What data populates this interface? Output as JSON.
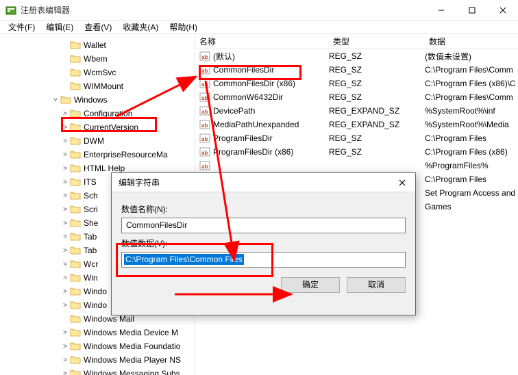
{
  "window": {
    "title": "注册表编辑器"
  },
  "menu": {
    "file": "文件(F)",
    "edit": "编辑(E)",
    "view": "查看(V)",
    "fav": "收藏夹(A)",
    "help": "帮助(H)"
  },
  "tree": [
    {
      "indent": 88,
      "expander": "",
      "label": "Wallet"
    },
    {
      "indent": 88,
      "expander": "",
      "label": "Wbem"
    },
    {
      "indent": 88,
      "expander": "",
      "label": "WcmSvc"
    },
    {
      "indent": 88,
      "expander": "",
      "label": "WIMMount"
    },
    {
      "indent": 74,
      "expander": "˅",
      "label": "Windows"
    },
    {
      "indent": 88,
      "expander": ">",
      "label": "Configuration"
    },
    {
      "indent": 88,
      "expander": ">",
      "label": "CurrentVersion",
      "highlight": true
    },
    {
      "indent": 88,
      "expander": ">",
      "label": "DWM"
    },
    {
      "indent": 88,
      "expander": ">",
      "label": "EnterpriseResourceMa"
    },
    {
      "indent": 88,
      "expander": ">",
      "label": "HTML Help"
    },
    {
      "indent": 88,
      "expander": ">",
      "label": "ITS"
    },
    {
      "indent": 88,
      "expander": ">",
      "label": "Sch"
    },
    {
      "indent": 88,
      "expander": ">",
      "label": "Scri"
    },
    {
      "indent": 88,
      "expander": ">",
      "label": "She"
    },
    {
      "indent": 88,
      "expander": ">",
      "label": "Tab"
    },
    {
      "indent": 88,
      "expander": ">",
      "label": "Tab"
    },
    {
      "indent": 88,
      "expander": ">",
      "label": "Wcr"
    },
    {
      "indent": 88,
      "expander": ">",
      "label": "Win"
    },
    {
      "indent": 88,
      "expander": ">",
      "label": "Windo"
    },
    {
      "indent": 88,
      "expander": ">",
      "label": "Windo"
    },
    {
      "indent": 88,
      "expander": "",
      "label": "Windows Mail"
    },
    {
      "indent": 88,
      "expander": ">",
      "label": "Windows Media Device M"
    },
    {
      "indent": 88,
      "expander": ">",
      "label": "Windows Media Foundatio"
    },
    {
      "indent": 88,
      "expander": ">",
      "label": "Windows Media Player NS"
    },
    {
      "indent": 88,
      "expander": ">",
      "label": "Windows Messaging Subs"
    }
  ],
  "list": {
    "headers": {
      "name": "名称",
      "type": "类型",
      "data": "数据"
    },
    "rows": [
      {
        "icon": "str",
        "name": "(默认)",
        "type": "REG_SZ",
        "data": "(数值未设置)"
      },
      {
        "icon": "str",
        "name": "CommonFilesDir",
        "type": "REG_SZ",
        "data": "C:\\Program Files\\Comm",
        "highlight": true
      },
      {
        "icon": "str",
        "name": "CommonFilesDir (x86)",
        "type": "REG_SZ",
        "data": "C:\\Program Files (x86)\\C"
      },
      {
        "icon": "str",
        "name": "CommonW6432Dir",
        "type": "REG_SZ",
        "data": "C:\\Program Files\\Comm"
      },
      {
        "icon": "str",
        "name": "DevicePath",
        "type": "REG_EXPAND_SZ",
        "data": "%SystemRoot%\\inf"
      },
      {
        "icon": "str",
        "name": "MediaPathUnexpanded",
        "type": "REG_EXPAND_SZ",
        "data": "%SystemRoot%\\Media"
      },
      {
        "icon": "str",
        "name": "ProgramFilesDir",
        "type": "REG_SZ",
        "data": "C:\\Program Files"
      },
      {
        "icon": "str",
        "name": "ProgramFilesDir (x86)",
        "type": "REG_SZ",
        "data": "C:\\Program Files (x86)"
      },
      {
        "icon": "str",
        "name": "",
        "type": "",
        "data": "%ProgramFiles%"
      },
      {
        "icon": "none",
        "name": "",
        "type": "",
        "data": "C:\\Program Files"
      },
      {
        "icon": "none",
        "name": "",
        "type": "",
        "data": "Set Program Access and"
      },
      {
        "icon": "none",
        "name": "",
        "type": "",
        "data": "Games"
      }
    ]
  },
  "dialog": {
    "title": "编辑字符串",
    "name_label": "数值名称(N):",
    "name_value": "CommonFilesDir",
    "data_label": "数值数据(V):",
    "data_value": "C:\\Program Files\\Common Files",
    "ok": "确定",
    "cancel": "取消"
  }
}
